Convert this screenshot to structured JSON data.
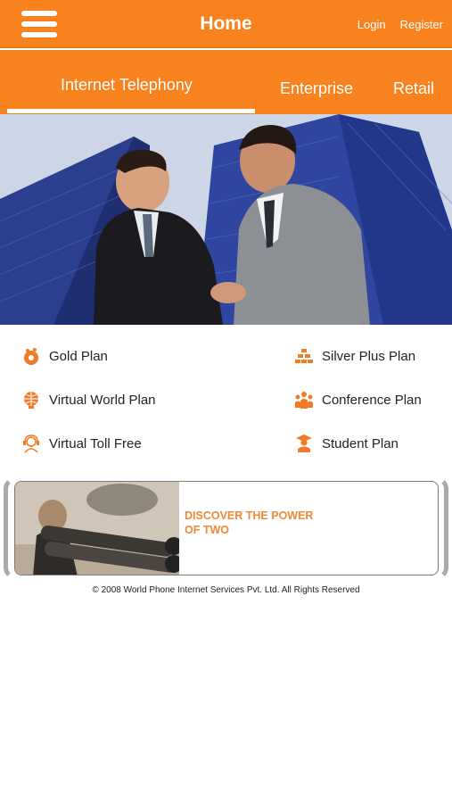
{
  "header": {
    "title": "Home",
    "login_label": "Login",
    "register_label": "Register",
    "accent_color": "#f7821e"
  },
  "tabs": [
    {
      "label": "Internet Telephony",
      "active": true
    },
    {
      "label": "Enterprise",
      "active": false
    },
    {
      "label": "Retail",
      "active": false
    }
  ],
  "plans": [
    {
      "label": "Gold Plan",
      "icon": "gold-coins-icon"
    },
    {
      "label": "Silver Plus Plan",
      "icon": "silver-bars-icon"
    },
    {
      "label": "Virtual World Plan",
      "icon": "globe-icon"
    },
    {
      "label": "Conference Plan",
      "icon": "group-people-icon"
    },
    {
      "label": "Virtual Toll Free",
      "icon": "support-agent-icon"
    },
    {
      "label": "Student Plan",
      "icon": "graduate-icon"
    }
  ],
  "banner": {
    "line1": "Discover the power",
    "line2": "of two"
  },
  "footer": {
    "copyright": "© 2008 World Phone Internet Services Pvt. Ltd. All Rights Reserved"
  }
}
